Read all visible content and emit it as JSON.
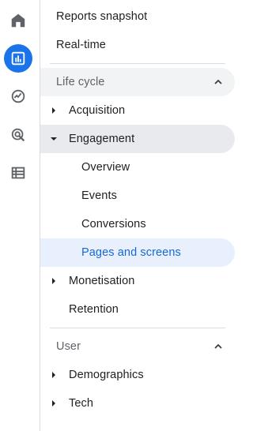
{
  "rail": {
    "items": [
      {
        "icon": "home-icon"
      },
      {
        "icon": "reports-icon",
        "active": true
      },
      {
        "icon": "explore-icon"
      },
      {
        "icon": "advertising-icon"
      },
      {
        "icon": "configure-icon"
      }
    ],
    "accent_color": "#1a73e8"
  },
  "nav": {
    "reports_snapshot": "Reports snapshot",
    "realtime": "Real-time",
    "lifecycle": {
      "label": "Life cycle",
      "acquisition": "Acquisition",
      "engagement": {
        "label": "Engagement",
        "overview": "Overview",
        "events": "Events",
        "conversions": "Conversions",
        "pages_and_screens": "Pages and screens"
      },
      "monetisation": "Monetisation",
      "retention": "Retention"
    },
    "user": {
      "label": "User",
      "demographics": "Demographics",
      "tech": "Tech"
    },
    "selected_color": "#1967d2"
  }
}
